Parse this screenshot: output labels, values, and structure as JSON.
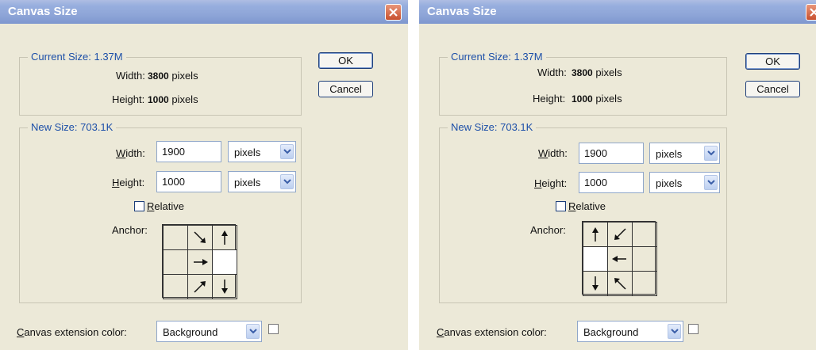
{
  "dialogs": [
    {
      "title": "Canvas Size",
      "current_size": {
        "legend": "Current Size: 1.37M",
        "width_label": "Width:",
        "width_value": "3800",
        "width_unit": "pixels",
        "height_label": "Height:",
        "height_value": "1000",
        "height_unit": "pixels"
      },
      "buttons": {
        "ok": "OK",
        "cancel": "Cancel"
      },
      "new_size": {
        "legend": "New Size: 703.1K",
        "width_label_u": "W",
        "width_label_rest": "idth:",
        "width_value": "1900",
        "width_unit": "pixels",
        "height_label_u": "H",
        "height_label_rest": "eight:",
        "height_value": "1000",
        "height_unit": "pixels",
        "relative_u": "R",
        "relative_rest": "elative",
        "relative_checked": false,
        "anchor_label": "Anchor:",
        "anchor_position": "middle-right"
      },
      "extension": {
        "label_u": "C",
        "label_rest": "anvas extension color:",
        "value": "Background"
      }
    },
    {
      "title": "Canvas Size",
      "current_size": {
        "legend": "Current Size: 1.37M",
        "width_label": "Width:",
        "width_value": "3800",
        "width_unit": "pixels",
        "height_label": "Height:",
        "height_value": "1000",
        "height_unit": "pixels"
      },
      "buttons": {
        "ok": "OK",
        "cancel": "Cancel"
      },
      "new_size": {
        "legend": "New Size: 703.1K",
        "width_label_u": "W",
        "width_label_rest": "idth:",
        "width_value": "1900",
        "width_unit": "pixels",
        "height_label_u": "H",
        "height_label_rest": "eight:",
        "height_value": "1000",
        "height_unit": "pixels",
        "relative_u": "R",
        "relative_rest": "elative",
        "relative_checked": false,
        "anchor_label": "Anchor:",
        "anchor_position": "middle-left"
      },
      "extension": {
        "label_u": "C",
        "label_rest": "anvas extension color:",
        "value": "Background"
      }
    }
  ],
  "colors": {
    "title_bar": "#8fa6d8",
    "legend_text": "#1c4fa8",
    "dialog_bg": "#ece9d8",
    "close_button": "#d9693f"
  },
  "icons": [
    "close-icon",
    "dropdown-arrow-icon",
    "anchor-arrow-icon"
  ]
}
